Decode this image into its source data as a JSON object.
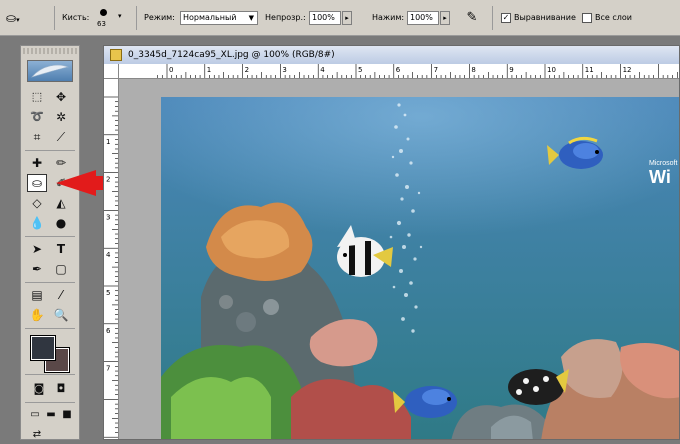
{
  "options_bar": {
    "brush_label": "Кисть:",
    "brush_size": "63",
    "mode_label": "Режим:",
    "mode_value": "Нормальный",
    "opacity_label": "Непрозр.:",
    "opacity_value": "100%",
    "pressure_label": "Нажим:",
    "pressure_value": "100%",
    "align_label": "Выравнивание",
    "align_checked": true,
    "all_layers_label": "Все слои",
    "all_layers_checked": false
  },
  "document": {
    "title": "0_3345d_7124ca95_XL.jpg @ 100% (RGB/8#)",
    "hruler_labels": [
      "0",
      "1",
      "2",
      "3",
      "4",
      "5",
      "6",
      "7",
      "8",
      "9",
      "10",
      "11",
      "12"
    ],
    "vruler_labels": [
      "1",
      "2",
      "3",
      "4",
      "5",
      "6",
      "7"
    ],
    "wallpaper_text": [
      "Microsoft",
      "Wi"
    ]
  },
  "toolbox": {
    "fg_color": "#303640",
    "bg_color": "#5a4848",
    "selected_tool": "clone-stamp"
  },
  "colors": {
    "arrow": "#e21b1b",
    "sea_top": "#4a86b8",
    "sea_bottom": "#2f7a86"
  }
}
